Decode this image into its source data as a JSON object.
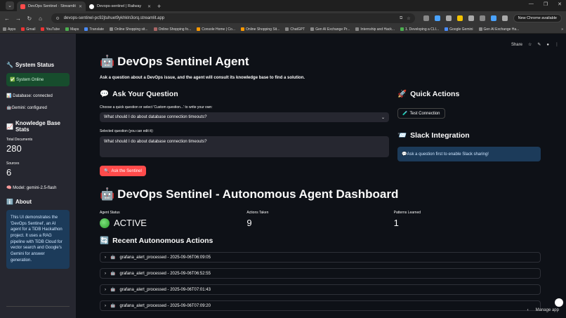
{
  "browser": {
    "tabs": [
      {
        "title": "DevOps Sentinel · Streamlit",
        "active": true
      },
      {
        "title": "Devops-sentinel | Railway",
        "active": false
      }
    ],
    "url": "devops-sentinel-pc92jtuhuet9ykhkln3orq.streamlit.app",
    "chrome_available": "New Chrome available",
    "bookmarks": [
      "Apps",
      "Gmail",
      "YouTube",
      "Maps",
      "Translate",
      "Online Shopping sit...",
      "Online Shopping fo...",
      "Console Home | Co...",
      "Online Shopping Sit...",
      "ChatGPT",
      "Gen AI Exchange Pr...",
      "Internship and Hack...",
      "1. Developing a CLI...",
      "Google Gemini",
      "Gen AI Exchange Ha..."
    ]
  },
  "sidebar": {
    "system_status_heading": "System Status",
    "system_online": "System Online",
    "database": "Database: connected",
    "gemini": "Gemini: configured",
    "kb_heading": "Knowledge Base Stats",
    "total_documents_label": "Total Documents",
    "total_documents": "280",
    "sources_label": "Sources",
    "sources": "6",
    "model": "Model: gemini-2.5-flash",
    "about_heading": "About",
    "about_text": "This UI demonstrates the 'DevOps Sentinel', an AI agent for a TiDB Hackathon project. It uses a RAG pipeline with TiDB Cloud for vector search and Google's Gemini for answer generation."
  },
  "header": {
    "share": "Share"
  },
  "main": {
    "title": "DevOps Sentinel Agent",
    "subtitle": "Ask a question about a DevOps issue, and the agent will consult its knowledge base to find a solution.",
    "ask_heading": "Ask Your Question",
    "select_label": "Choose a quick question or select 'Custom question...' to write your own:",
    "select_value": "What should I do about database connection timeouts?",
    "edit_label": "Selected question (you can edit it):",
    "edit_value": "What should I do about database connection timeouts?",
    "ask_button": "Ask the Sentinel",
    "quick_actions_heading": "Quick Actions",
    "test_connection": "Test Connection",
    "slack_heading": "Slack Integration",
    "slack_info": "Ask a question first to enable Slack sharing!",
    "dashboard_title": "DevOps Sentinel - Autonomous Agent Dashboard",
    "metrics": [
      {
        "label": "Agent Status",
        "value": "ACTIVE"
      },
      {
        "label": "Actions Taken",
        "value": "9"
      },
      {
        "label": "Patterns Learned",
        "value": "1"
      }
    ],
    "recent_heading": "Recent Autonomous Actions",
    "actions": [
      "grafana_alert_processed - 2025-09-06T06:09:05",
      "grafana_alert_processed - 2025-09-06T06:52:55",
      "grafana_alert_processed - 2025-09-06T07:01:43",
      "grafana_alert_processed - 2025-09-06T07:09:20"
    ]
  },
  "footer": {
    "manage_app": "Manage app"
  }
}
